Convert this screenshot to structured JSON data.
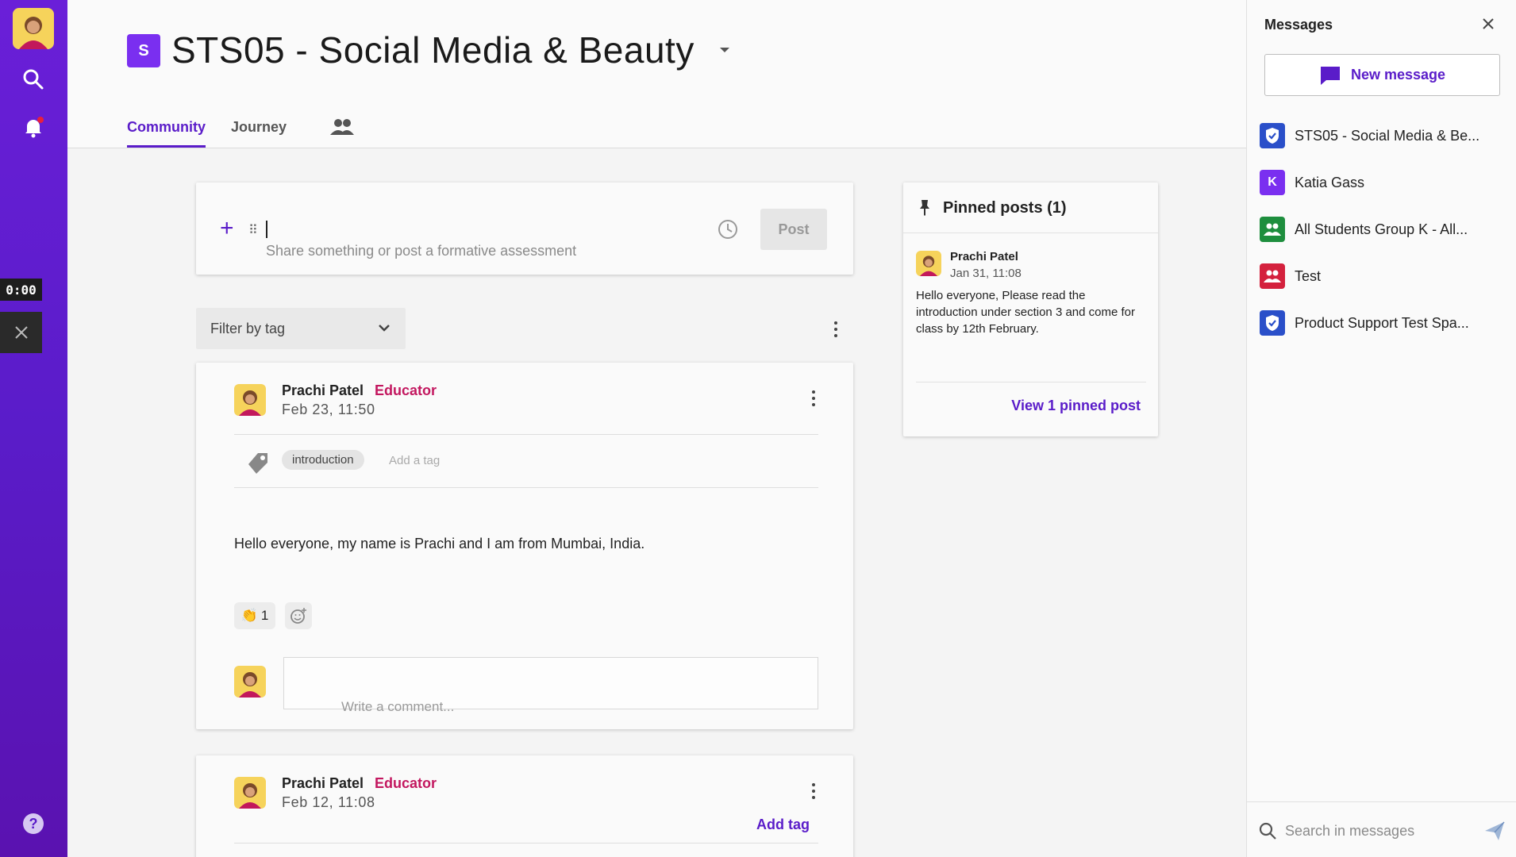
{
  "rail": {
    "timer": "0:00"
  },
  "header": {
    "space_badge": "S",
    "space_title": "STS05 - Social Media & Beauty",
    "tabs": [
      {
        "label": "Community",
        "active": true
      },
      {
        "label": "Journey",
        "active": false
      }
    ]
  },
  "composer": {
    "placeholder": "Share something or post a formative assessment",
    "post_label": "Post"
  },
  "filter": {
    "label": "Filter by tag"
  },
  "posts": [
    {
      "author": "Prachi Patel",
      "role": "Educator",
      "date": "Feb 23, 11:50",
      "tag": "introduction",
      "add_tag_placeholder": "Add a tag",
      "body": "Hello everyone, my name is Prachi and I am from Mumbai, India.",
      "reaction_count": "1",
      "comment_placeholder": "Write a comment..."
    },
    {
      "author": "Prachi Patel",
      "role": "Educator",
      "date": "Feb 12, 11:08",
      "add_tag_label": "Add tag"
    }
  ],
  "pinned": {
    "title": "Pinned posts (1)",
    "author": "Prachi Patel",
    "date": "Jan 31, 11:08",
    "body": "Hello everyone, Please read the introduction under section 3 and come for class by 12th February.",
    "view_label": "View 1 pinned post"
  },
  "messages": {
    "title": "Messages",
    "new_message_label": "New message",
    "conversations": [
      {
        "name": "STS05 - Social Media & Be...",
        "icon": "shield-check-icon",
        "color": "#2a4fc9"
      },
      {
        "name": "Katia Gass",
        "icon": "K",
        "color": "#7a2ff0"
      },
      {
        "name": "All Students Group K - All...",
        "icon": "group-icon",
        "color": "#1e8e3e"
      },
      {
        "name": "Test",
        "icon": "group-icon",
        "color": "#d4213d"
      },
      {
        "name": "Product Support Test Spa...",
        "icon": "shield-check-icon",
        "color": "#2a4fc9"
      }
    ],
    "search_placeholder": "Search in messages"
  },
  "colors": {
    "accent": "#5a1cc9",
    "educator": "#c3175f",
    "rail": "#6a1fd8"
  }
}
